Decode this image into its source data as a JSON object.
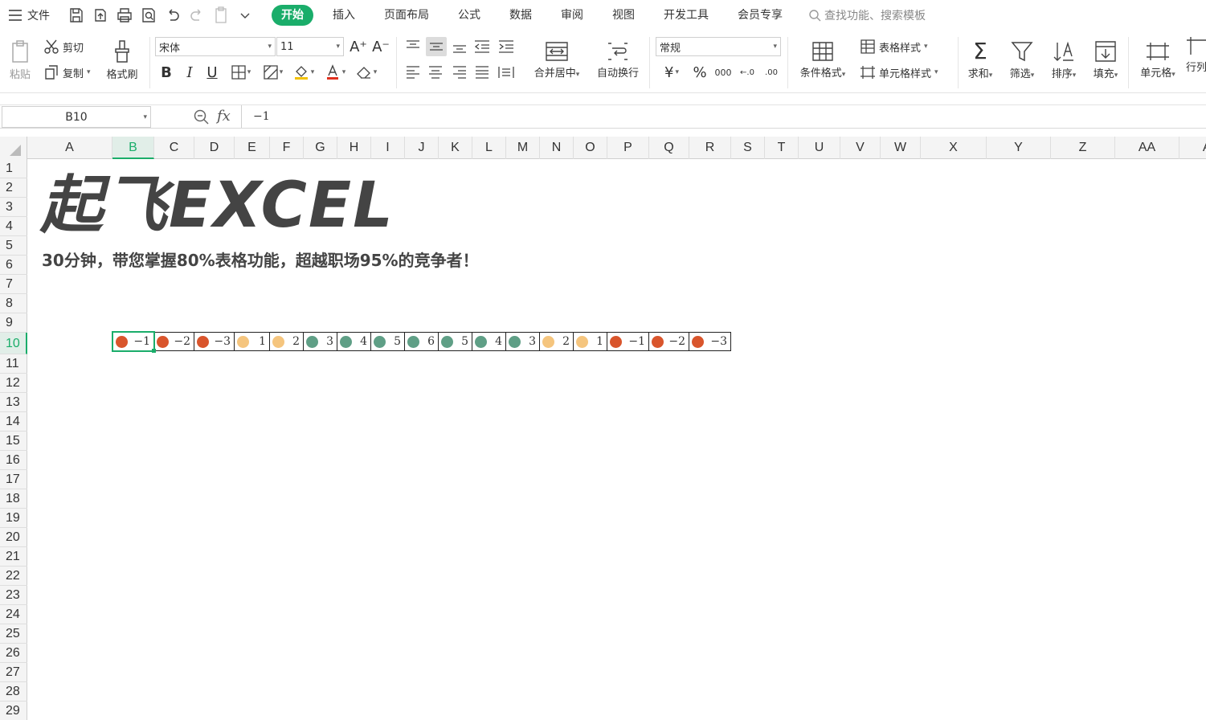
{
  "menubar": {
    "file_label": "文件",
    "tabs": [
      {
        "label": "开始",
        "active": true
      },
      {
        "label": "插入"
      },
      {
        "label": "页面布局"
      },
      {
        "label": "公式"
      },
      {
        "label": "数据"
      },
      {
        "label": "审阅"
      },
      {
        "label": "视图"
      },
      {
        "label": "开发工具"
      },
      {
        "label": "会员专享"
      }
    ],
    "search_placeholder": "查找功能、搜索模板"
  },
  "ribbon": {
    "paste": "粘贴",
    "cut": "剪切",
    "copy": "复制",
    "format_painter": "格式刷",
    "font_name": "宋体",
    "font_size": "11",
    "merge_center": "合并居中",
    "wrap_text": "自动换行",
    "number_format": "常规",
    "conditional_format": "条件格式",
    "table_style": "表格样式",
    "cell_style": "单元格样式",
    "sum": "求和",
    "filter": "筛选",
    "sort": "排序",
    "fill": "填充",
    "cell": "单元格",
    "row_col": "行列"
  },
  "formula_bar": {
    "name_box": "B10",
    "fx": "fx",
    "value": "−1"
  },
  "sheet": {
    "columns": [
      "A",
      "B",
      "C",
      "D",
      "E",
      "F",
      "G",
      "H",
      "I",
      "J",
      "K",
      "L",
      "M",
      "N",
      "O",
      "P",
      "Q",
      "R",
      "S",
      "T",
      "U",
      "V",
      "W",
      "X",
      "Y",
      "Z",
      "AA",
      "AB"
    ],
    "selected_column": "B",
    "rows": [
      "1",
      "2",
      "3",
      "4",
      "5",
      "6",
      "7",
      "8",
      "9",
      "10",
      "11",
      "12",
      "13",
      "14",
      "15",
      "16",
      "17",
      "18",
      "19",
      "20",
      "21",
      "22",
      "23",
      "24",
      "25",
      "26",
      "27",
      "28",
      "29"
    ],
    "selected_row": "10",
    "brand": "起飞EXCEL",
    "tagline": "30分钟，带您掌握80%表格功能，超越职场95%的竞争者！",
    "row10_cells": [
      {
        "col": "B",
        "value": "−1",
        "dot": "red"
      },
      {
        "col": "C",
        "value": "−2",
        "dot": "red"
      },
      {
        "col": "D",
        "value": "−3",
        "dot": "red"
      },
      {
        "col": "E",
        "value": "1",
        "dot": "yellow"
      },
      {
        "col": "F",
        "value": "2",
        "dot": "yellow"
      },
      {
        "col": "G",
        "value": "3",
        "dot": "green"
      },
      {
        "col": "H",
        "value": "4",
        "dot": "green"
      },
      {
        "col": "I",
        "value": "5",
        "dot": "green"
      },
      {
        "col": "J",
        "value": "6",
        "dot": "green"
      },
      {
        "col": "K",
        "value": "5",
        "dot": "green"
      },
      {
        "col": "L",
        "value": "4",
        "dot": "green"
      },
      {
        "col": "M",
        "value": "3",
        "dot": "green"
      },
      {
        "col": "N",
        "value": "2",
        "dot": "yellow"
      },
      {
        "col": "O",
        "value": "1",
        "dot": "yellow"
      },
      {
        "col": "P",
        "value": "−1",
        "dot": "red"
      },
      {
        "col": "Q",
        "value": "−2",
        "dot": "red"
      },
      {
        "col": "R",
        "value": "−3",
        "dot": "red"
      }
    ]
  },
  "colors": {
    "accent": "#1aad6a",
    "dot_red": "#d9552c",
    "dot_yellow": "#f5c57e",
    "dot_green": "#5f9f86"
  }
}
